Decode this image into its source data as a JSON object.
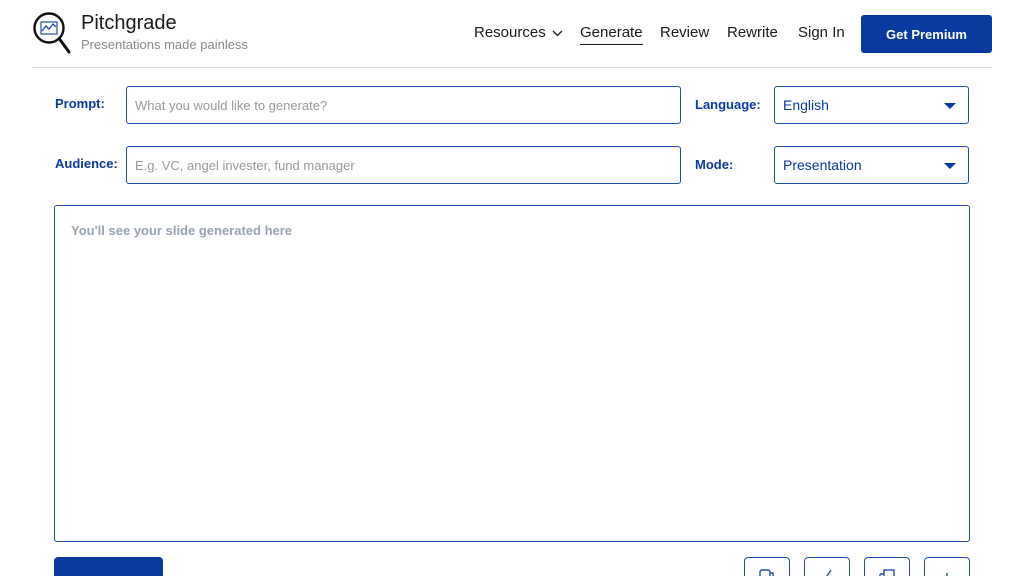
{
  "brand": {
    "name": "Pitchgrade",
    "tagline": "Presentations made painless"
  },
  "nav": {
    "resources": "Resources",
    "generate": "Generate",
    "review": "Review",
    "rewrite": "Rewrite",
    "signin": "Sign In",
    "premium": "Get Premium"
  },
  "form": {
    "prompt_label": "Prompt:",
    "prompt_placeholder": "What you would like to generate?",
    "audience_label": "Audience:",
    "audience_placeholder": "E.g. VC, angel invester, fund manager",
    "language_label": "Language:",
    "language_value": "English",
    "mode_label": "Mode:",
    "mode_value": "Presentation"
  },
  "slide": {
    "hint": "You'll see your slide generated here"
  },
  "colors": {
    "accent": "#0a3a9e",
    "border": "#1f4fa8"
  },
  "icons": {
    "logo": "magnifier-chart-icon",
    "tools": [
      "copy-icon",
      "edit-icon",
      "duplicate-icon",
      "add-icon"
    ]
  }
}
